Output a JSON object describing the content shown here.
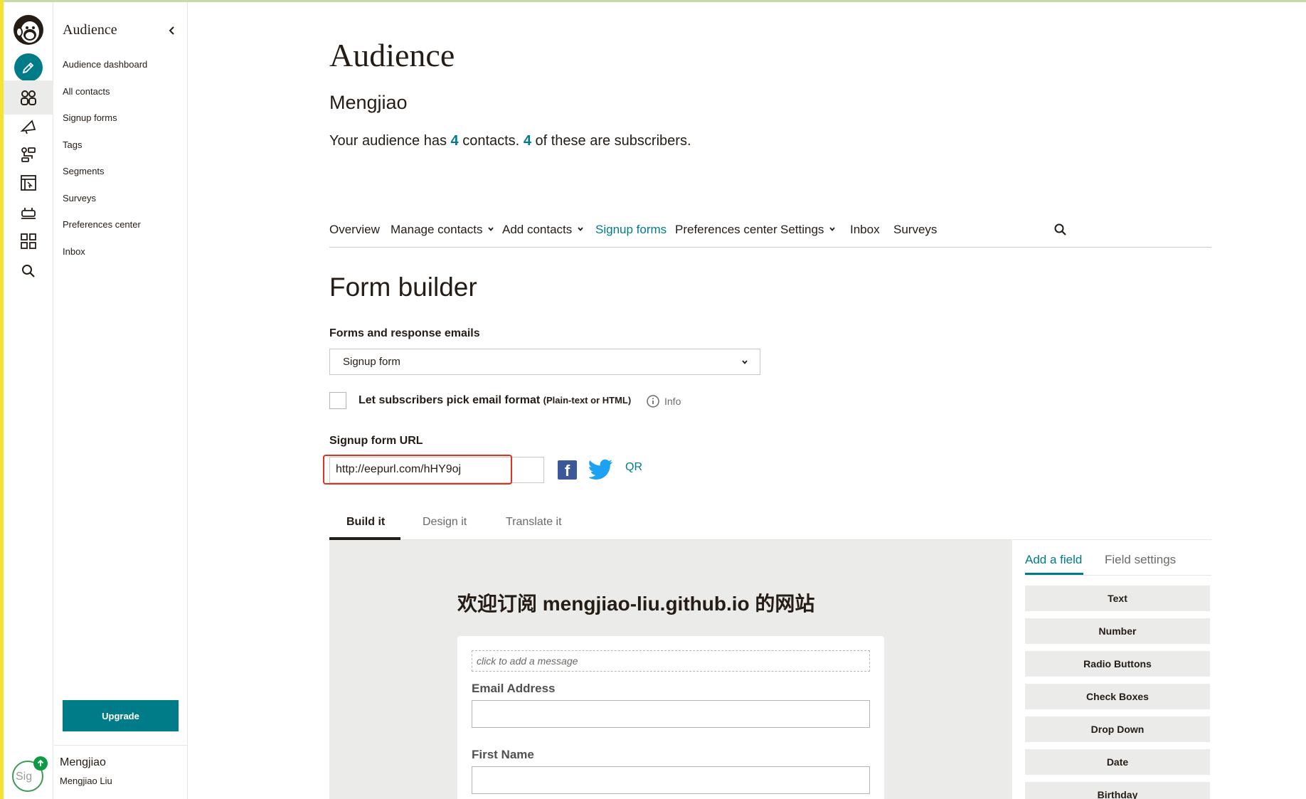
{
  "colors": {
    "brand": "#007c89",
    "highlight": "#e0321e"
  },
  "rail": {
    "icons": [
      "freddie-logo",
      "pencil-icon",
      "audience-icon",
      "megaphone-icon",
      "automation-icon",
      "website-icon",
      "integrations-icon",
      "grid-icon",
      "search-icon"
    ],
    "avatar_alt": "Sig"
  },
  "nav": {
    "title": "Audience",
    "items": [
      {
        "label": "Audience dashboard"
      },
      {
        "label": "All contacts"
      },
      {
        "label": "Signup forms"
      },
      {
        "label": "Tags"
      },
      {
        "label": "Segments"
      },
      {
        "label": "Surveys"
      },
      {
        "label": "Preferences center"
      },
      {
        "label": "Inbox"
      }
    ],
    "upgrade_label": "Upgrade",
    "user": {
      "display_name": "Mengjiao",
      "full_name": "Mengjiao Liu"
    }
  },
  "header": {
    "title": "Audience",
    "audience_name": "Mengjiao",
    "summary_prefix": "Your audience has",
    "contacts_count": "4",
    "summary_mid": "contacts.",
    "subscribers_count": "4",
    "summary_suffix": "of these are subscribers."
  },
  "tabs": [
    {
      "label": "Overview"
    },
    {
      "label": "Manage contacts"
    },
    {
      "label": "Add contacts"
    },
    {
      "label": "Signup forms"
    },
    {
      "label": "Preferences center"
    },
    {
      "label": "Settings"
    },
    {
      "label": "Inbox"
    },
    {
      "label": "Surveys"
    }
  ],
  "form_builder": {
    "title": "Form builder",
    "forms_label": "Forms and response emails",
    "selected_form": "Signup form",
    "checkbox_label": "Let subscribers pick email format",
    "checkbox_hint": "(Plain-text or HTML)",
    "info_label": "Info",
    "url_label": "Signup form URL",
    "url_value": "http://eepurl.com/hHY9oj",
    "qr_label": "QR",
    "builder_tabs": [
      {
        "label": "Build it"
      },
      {
        "label": "Design it"
      },
      {
        "label": "Translate it"
      }
    ],
    "preview": {
      "heading": "欢迎订阅 mengjiao-liu.github.io 的网站",
      "message_placeholder": "click to add a message",
      "fields": [
        {
          "label": "Email Address"
        },
        {
          "label": "First Name"
        }
      ]
    },
    "panel": {
      "tabs": [
        {
          "label": "Add a field"
        },
        {
          "label": "Field settings"
        }
      ],
      "field_types": [
        "Text",
        "Number",
        "Radio Buttons",
        "Check Boxes",
        "Drop Down",
        "Date",
        "Birthday"
      ]
    }
  }
}
